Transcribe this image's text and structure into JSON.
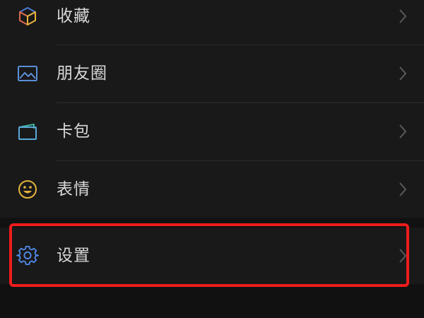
{
  "menu": {
    "items": [
      {
        "label": "收藏",
        "icon": "favorites-cube-icon"
      },
      {
        "label": "朋友圈",
        "icon": "moments-picture-icon"
      },
      {
        "label": "卡包",
        "icon": "card-wallet-icon"
      },
      {
        "label": "表情",
        "icon": "smiley-face-icon"
      }
    ],
    "settings": {
      "label": "设置",
      "icon": "gear-icon"
    }
  },
  "colors": {
    "background": "#111111",
    "row_background": "#191919",
    "text": "#d8d8d8",
    "chevron": "#5a5a5a",
    "highlight": "#ee1c1c"
  }
}
